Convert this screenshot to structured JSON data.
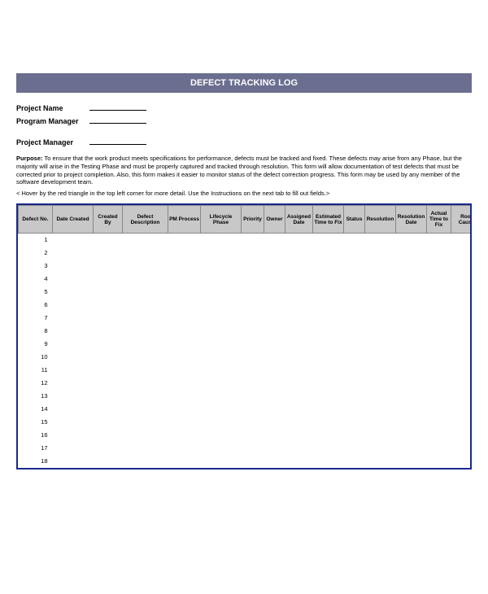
{
  "title": "DEFECT TRACKING LOG",
  "meta": {
    "project_name_label": "Project Name",
    "program_manager_label": "Program Manager",
    "project_manager_label": "Project Manager",
    "project_name_value": "",
    "program_manager_value": "",
    "project_manager_value": ""
  },
  "purpose_label": "Purpose:",
  "purpose_text": "To ensure that the work product meets specifications for performance, defects must be tracked and fixed. These defects may arise from any Phase, but the majority will arise in the Testing Phase and must be properly captured and tracked through resolution. This form will allow documentation of test defects that must be corrected prior to project completion. Also, this form makes it easier to monitor status of the defect correction progress. This form may be used by any member of the software development team.",
  "note_text": "< Hover by the red triangle in the top left corner for more detail. Use the Instructions on the next tab to fill out fields.>",
  "columns": [
    "Defect No.",
    "Date Created",
    "Created By",
    "Defect Description",
    "PM Process",
    "Lifecycle Phase",
    "Priority",
    "Owner",
    "Assigned Date",
    "Estimated Time to Fix",
    "Status",
    "Resolution",
    "Resolution Date",
    "Actual Time to Fix",
    "Root Cause"
  ],
  "chart_data": {
    "type": "table",
    "columns": [
      "Defect No.",
      "Date Created",
      "Created By",
      "Defect Description",
      "PM Process",
      "Lifecycle Phase",
      "Priority",
      "Owner",
      "Assigned Date",
      "Estimated Time to Fix",
      "Status",
      "Resolution",
      "Resolution Date",
      "Actual Time to Fix",
      "Root Cause"
    ],
    "rows": [
      [
        "1",
        "",
        "",
        "",
        "",
        "",
        "",
        "",
        "",
        "",
        "",
        "",
        "",
        "",
        ""
      ],
      [
        "2",
        "",
        "",
        "",
        "",
        "",
        "",
        "",
        "",
        "",
        "",
        "",
        "",
        "",
        ""
      ],
      [
        "3",
        "",
        "",
        "",
        "",
        "",
        "",
        "",
        "",
        "",
        "",
        "",
        "",
        "",
        ""
      ],
      [
        "4",
        "",
        "",
        "",
        "",
        "",
        "",
        "",
        "",
        "",
        "",
        "",
        "",
        "",
        ""
      ],
      [
        "5",
        "",
        "",
        "",
        "",
        "",
        "",
        "",
        "",
        "",
        "",
        "",
        "",
        "",
        ""
      ],
      [
        "6",
        "",
        "",
        "",
        "",
        "",
        "",
        "",
        "",
        "",
        "",
        "",
        "",
        "",
        ""
      ],
      [
        "7",
        "",
        "",
        "",
        "",
        "",
        "",
        "",
        "",
        "",
        "",
        "",
        "",
        "",
        ""
      ],
      [
        "8",
        "",
        "",
        "",
        "",
        "",
        "",
        "",
        "",
        "",
        "",
        "",
        "",
        "",
        ""
      ],
      [
        "9",
        "",
        "",
        "",
        "",
        "",
        "",
        "",
        "",
        "",
        "",
        "",
        "",
        "",
        ""
      ],
      [
        "10",
        "",
        "",
        "",
        "",
        "",
        "",
        "",
        "",
        "",
        "",
        "",
        "",
        "",
        ""
      ],
      [
        "11",
        "",
        "",
        "",
        "",
        "",
        "",
        "",
        "",
        "",
        "",
        "",
        "",
        "",
        ""
      ],
      [
        "12",
        "",
        "",
        "",
        "",
        "",
        "",
        "",
        "",
        "",
        "",
        "",
        "",
        "",
        ""
      ],
      [
        "13",
        "",
        "",
        "",
        "",
        "",
        "",
        "",
        "",
        "",
        "",
        "",
        "",
        "",
        ""
      ],
      [
        "14",
        "",
        "",
        "",
        "",
        "",
        "",
        "",
        "",
        "",
        "",
        "",
        "",
        "",
        ""
      ],
      [
        "15",
        "",
        "",
        "",
        "",
        "",
        "",
        "",
        "",
        "",
        "",
        "",
        "",
        "",
        ""
      ],
      [
        "16",
        "",
        "",
        "",
        "",
        "",
        "",
        "",
        "",
        "",
        "",
        "",
        "",
        "",
        ""
      ],
      [
        "17",
        "",
        "",
        "",
        "",
        "",
        "",
        "",
        "",
        "",
        "",
        "",
        "",
        "",
        ""
      ],
      [
        "18",
        "",
        "",
        "",
        "",
        "",
        "",
        "",
        "",
        "",
        "",
        "",
        "",
        "",
        ""
      ]
    ]
  }
}
